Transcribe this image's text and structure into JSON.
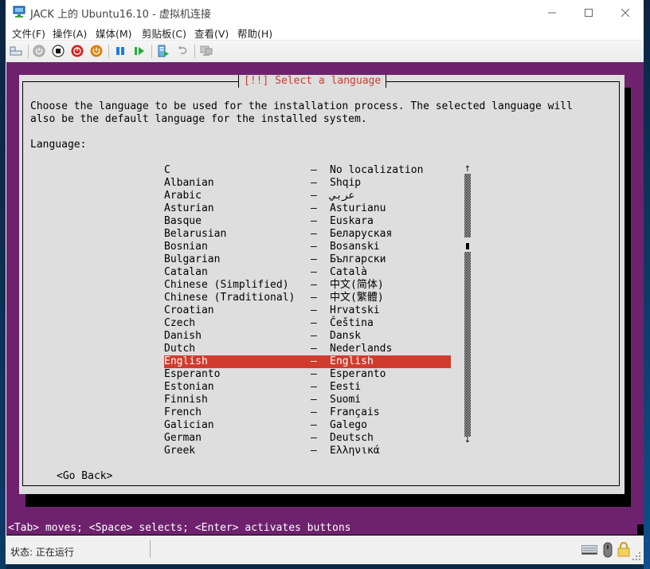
{
  "window": {
    "title": "JACK 上的 Ubuntu16.10 - 虚拟机连接",
    "controls": {
      "minimize": "—",
      "maximize": "☐",
      "close": "✕"
    }
  },
  "menu": [
    {
      "label": "文件(F)"
    },
    {
      "label": "操作(A)"
    },
    {
      "label": "媒体(M)"
    },
    {
      "label": "剪贴板(C)"
    },
    {
      "label": "查看(V)"
    },
    {
      "label": "帮助(H)"
    }
  ],
  "toolbar": {
    "buttons": [
      {
        "icon": "ctrl-alt-del-icon"
      },
      {
        "icon": "start-icon-disabled"
      },
      {
        "icon": "turn-off-icon"
      },
      {
        "icon": "shutdown-icon"
      },
      {
        "icon": "save-state-icon"
      },
      {
        "icon": "pause-icon"
      },
      {
        "icon": "resume-icon"
      },
      {
        "icon": "checkpoint-icon"
      },
      {
        "icon": "revert-icon"
      },
      {
        "icon": "enhanced-session-icon"
      }
    ]
  },
  "colors": {
    "installer_bg": "#6e226d",
    "dialog_bg": "#dedede",
    "accent_red": "#d13b2e"
  },
  "installer": {
    "dialog_title": "[!!] Select a language",
    "description_line1": "Choose the language to be used for the installation process. The selected language will",
    "description_line2": "also be the default language for the installed system.",
    "language_label": "Language:",
    "separator": "–",
    "selected_index": 15,
    "languages": [
      {
        "name": "C",
        "native": "No localization"
      },
      {
        "name": "Albanian",
        "native": "Shqip"
      },
      {
        "name": "Arabic",
        "native": "عربي"
      },
      {
        "name": "Asturian",
        "native": "Asturianu"
      },
      {
        "name": "Basque",
        "native": "Euskara"
      },
      {
        "name": "Belarusian",
        "native": "Беларуская"
      },
      {
        "name": "Bosnian",
        "native": "Bosanski"
      },
      {
        "name": "Bulgarian",
        "native": "Български"
      },
      {
        "name": "Catalan",
        "native": "Català"
      },
      {
        "name": "Chinese (Simplified)",
        "native": "中文(简体)"
      },
      {
        "name": "Chinese (Traditional)",
        "native": "中文(繁體)"
      },
      {
        "name": "Croatian",
        "native": "Hrvatski"
      },
      {
        "name": "Czech",
        "native": "Čeština"
      },
      {
        "name": "Danish",
        "native": "Dansk"
      },
      {
        "name": "Dutch",
        "native": "Nederlands"
      },
      {
        "name": "English",
        "native": "English"
      },
      {
        "name": "Esperanto",
        "native": "Esperanto"
      },
      {
        "name": "Estonian",
        "native": "Eesti"
      },
      {
        "name": "Finnish",
        "native": "Suomi"
      },
      {
        "name": "French",
        "native": "Français"
      },
      {
        "name": "Galician",
        "native": "Galego"
      },
      {
        "name": "German",
        "native": "Deutsch"
      },
      {
        "name": "Greek",
        "native": "Ελληνικά"
      }
    ],
    "scroll": {
      "up_arrow": "↑",
      "down_arrow": "↓",
      "position_fraction": 0.28
    },
    "go_back": "<Go Back>",
    "hint": "<Tab> moves; <Space> selects; <Enter> activates buttons"
  },
  "status": {
    "text": "状态: 正在运行",
    "icons": [
      "keyboard-icon",
      "mouse-icon",
      "lock-icon"
    ]
  }
}
